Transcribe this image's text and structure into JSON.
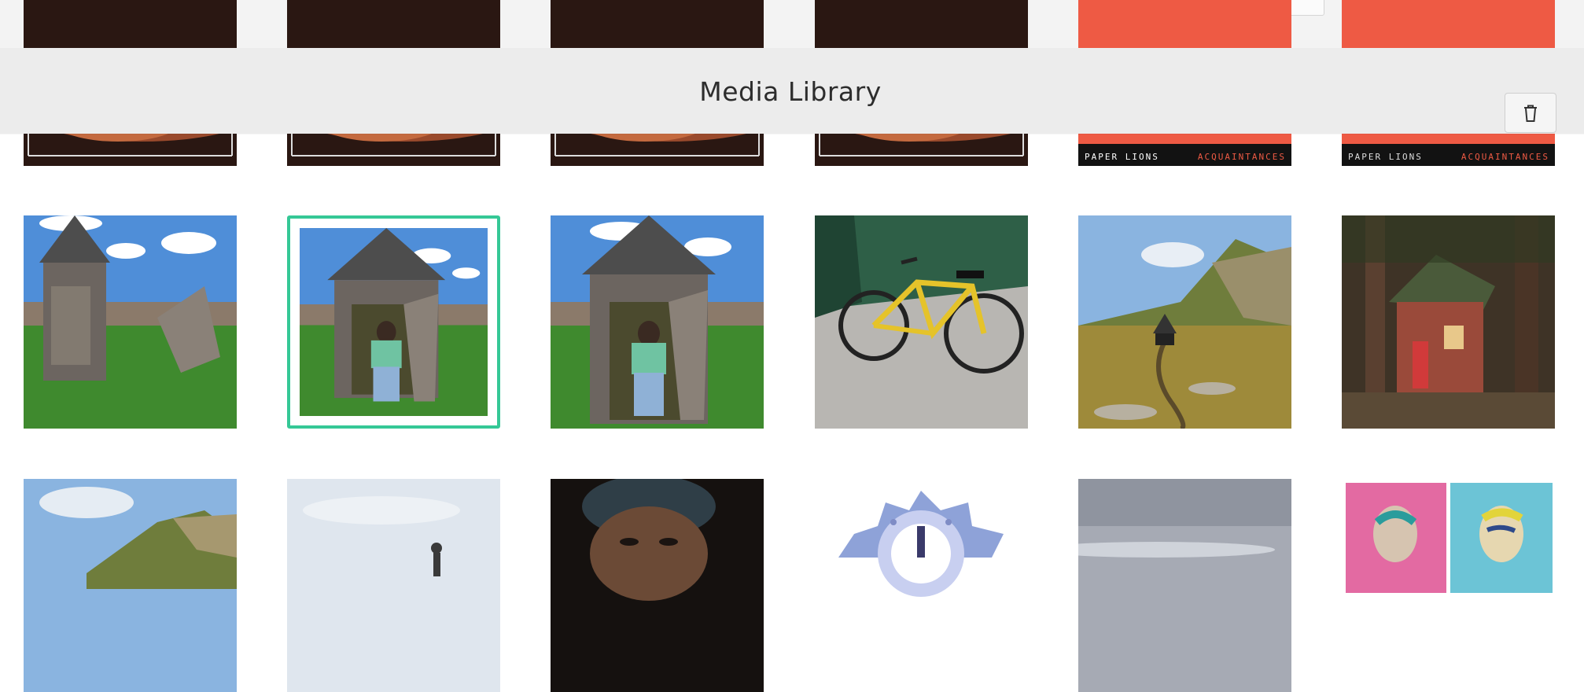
{
  "header": {
    "title": "Media Library",
    "delete_icon": "trash-icon"
  },
  "albums": {
    "artist": "PAPER LIONS",
    "album": "ACQUAINTANCES"
  },
  "colors": {
    "selection": "#35c896",
    "header_bg": "#ececec",
    "cover_orange": "#ee5a44"
  },
  "selected_index": 1
}
